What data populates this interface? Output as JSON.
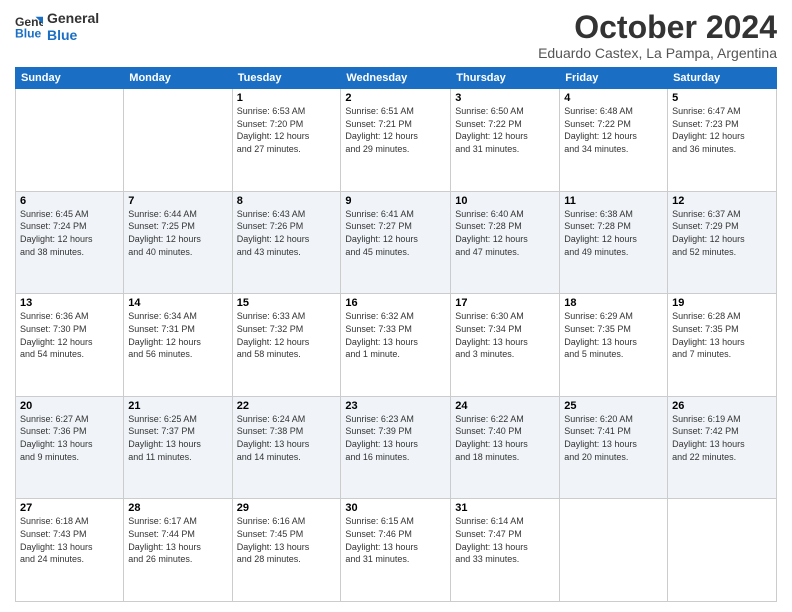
{
  "header": {
    "logo_line1": "General",
    "logo_line2": "Blue",
    "month_title": "October 2024",
    "location": "Eduardo Castex, La Pampa, Argentina"
  },
  "weekdays": [
    "Sunday",
    "Monday",
    "Tuesday",
    "Wednesday",
    "Thursday",
    "Friday",
    "Saturday"
  ],
  "weeks": [
    [
      {
        "day": "",
        "info": ""
      },
      {
        "day": "",
        "info": ""
      },
      {
        "day": "1",
        "info": "Sunrise: 6:53 AM\nSunset: 7:20 PM\nDaylight: 12 hours\nand 27 minutes."
      },
      {
        "day": "2",
        "info": "Sunrise: 6:51 AM\nSunset: 7:21 PM\nDaylight: 12 hours\nand 29 minutes."
      },
      {
        "day": "3",
        "info": "Sunrise: 6:50 AM\nSunset: 7:22 PM\nDaylight: 12 hours\nand 31 minutes."
      },
      {
        "day": "4",
        "info": "Sunrise: 6:48 AM\nSunset: 7:22 PM\nDaylight: 12 hours\nand 34 minutes."
      },
      {
        "day": "5",
        "info": "Sunrise: 6:47 AM\nSunset: 7:23 PM\nDaylight: 12 hours\nand 36 minutes."
      }
    ],
    [
      {
        "day": "6",
        "info": "Sunrise: 6:45 AM\nSunset: 7:24 PM\nDaylight: 12 hours\nand 38 minutes."
      },
      {
        "day": "7",
        "info": "Sunrise: 6:44 AM\nSunset: 7:25 PM\nDaylight: 12 hours\nand 40 minutes."
      },
      {
        "day": "8",
        "info": "Sunrise: 6:43 AM\nSunset: 7:26 PM\nDaylight: 12 hours\nand 43 minutes."
      },
      {
        "day": "9",
        "info": "Sunrise: 6:41 AM\nSunset: 7:27 PM\nDaylight: 12 hours\nand 45 minutes."
      },
      {
        "day": "10",
        "info": "Sunrise: 6:40 AM\nSunset: 7:28 PM\nDaylight: 12 hours\nand 47 minutes."
      },
      {
        "day": "11",
        "info": "Sunrise: 6:38 AM\nSunset: 7:28 PM\nDaylight: 12 hours\nand 49 minutes."
      },
      {
        "day": "12",
        "info": "Sunrise: 6:37 AM\nSunset: 7:29 PM\nDaylight: 12 hours\nand 52 minutes."
      }
    ],
    [
      {
        "day": "13",
        "info": "Sunrise: 6:36 AM\nSunset: 7:30 PM\nDaylight: 12 hours\nand 54 minutes."
      },
      {
        "day": "14",
        "info": "Sunrise: 6:34 AM\nSunset: 7:31 PM\nDaylight: 12 hours\nand 56 minutes."
      },
      {
        "day": "15",
        "info": "Sunrise: 6:33 AM\nSunset: 7:32 PM\nDaylight: 12 hours\nand 58 minutes."
      },
      {
        "day": "16",
        "info": "Sunrise: 6:32 AM\nSunset: 7:33 PM\nDaylight: 13 hours\nand 1 minute."
      },
      {
        "day": "17",
        "info": "Sunrise: 6:30 AM\nSunset: 7:34 PM\nDaylight: 13 hours\nand 3 minutes."
      },
      {
        "day": "18",
        "info": "Sunrise: 6:29 AM\nSunset: 7:35 PM\nDaylight: 13 hours\nand 5 minutes."
      },
      {
        "day": "19",
        "info": "Sunrise: 6:28 AM\nSunset: 7:35 PM\nDaylight: 13 hours\nand 7 minutes."
      }
    ],
    [
      {
        "day": "20",
        "info": "Sunrise: 6:27 AM\nSunset: 7:36 PM\nDaylight: 13 hours\nand 9 minutes."
      },
      {
        "day": "21",
        "info": "Sunrise: 6:25 AM\nSunset: 7:37 PM\nDaylight: 13 hours\nand 11 minutes."
      },
      {
        "day": "22",
        "info": "Sunrise: 6:24 AM\nSunset: 7:38 PM\nDaylight: 13 hours\nand 14 minutes."
      },
      {
        "day": "23",
        "info": "Sunrise: 6:23 AM\nSunset: 7:39 PM\nDaylight: 13 hours\nand 16 minutes."
      },
      {
        "day": "24",
        "info": "Sunrise: 6:22 AM\nSunset: 7:40 PM\nDaylight: 13 hours\nand 18 minutes."
      },
      {
        "day": "25",
        "info": "Sunrise: 6:20 AM\nSunset: 7:41 PM\nDaylight: 13 hours\nand 20 minutes."
      },
      {
        "day": "26",
        "info": "Sunrise: 6:19 AM\nSunset: 7:42 PM\nDaylight: 13 hours\nand 22 minutes."
      }
    ],
    [
      {
        "day": "27",
        "info": "Sunrise: 6:18 AM\nSunset: 7:43 PM\nDaylight: 13 hours\nand 24 minutes."
      },
      {
        "day": "28",
        "info": "Sunrise: 6:17 AM\nSunset: 7:44 PM\nDaylight: 13 hours\nand 26 minutes."
      },
      {
        "day": "29",
        "info": "Sunrise: 6:16 AM\nSunset: 7:45 PM\nDaylight: 13 hours\nand 28 minutes."
      },
      {
        "day": "30",
        "info": "Sunrise: 6:15 AM\nSunset: 7:46 PM\nDaylight: 13 hours\nand 31 minutes."
      },
      {
        "day": "31",
        "info": "Sunrise: 6:14 AM\nSunset: 7:47 PM\nDaylight: 13 hours\nand 33 minutes."
      },
      {
        "day": "",
        "info": ""
      },
      {
        "day": "",
        "info": ""
      }
    ]
  ]
}
